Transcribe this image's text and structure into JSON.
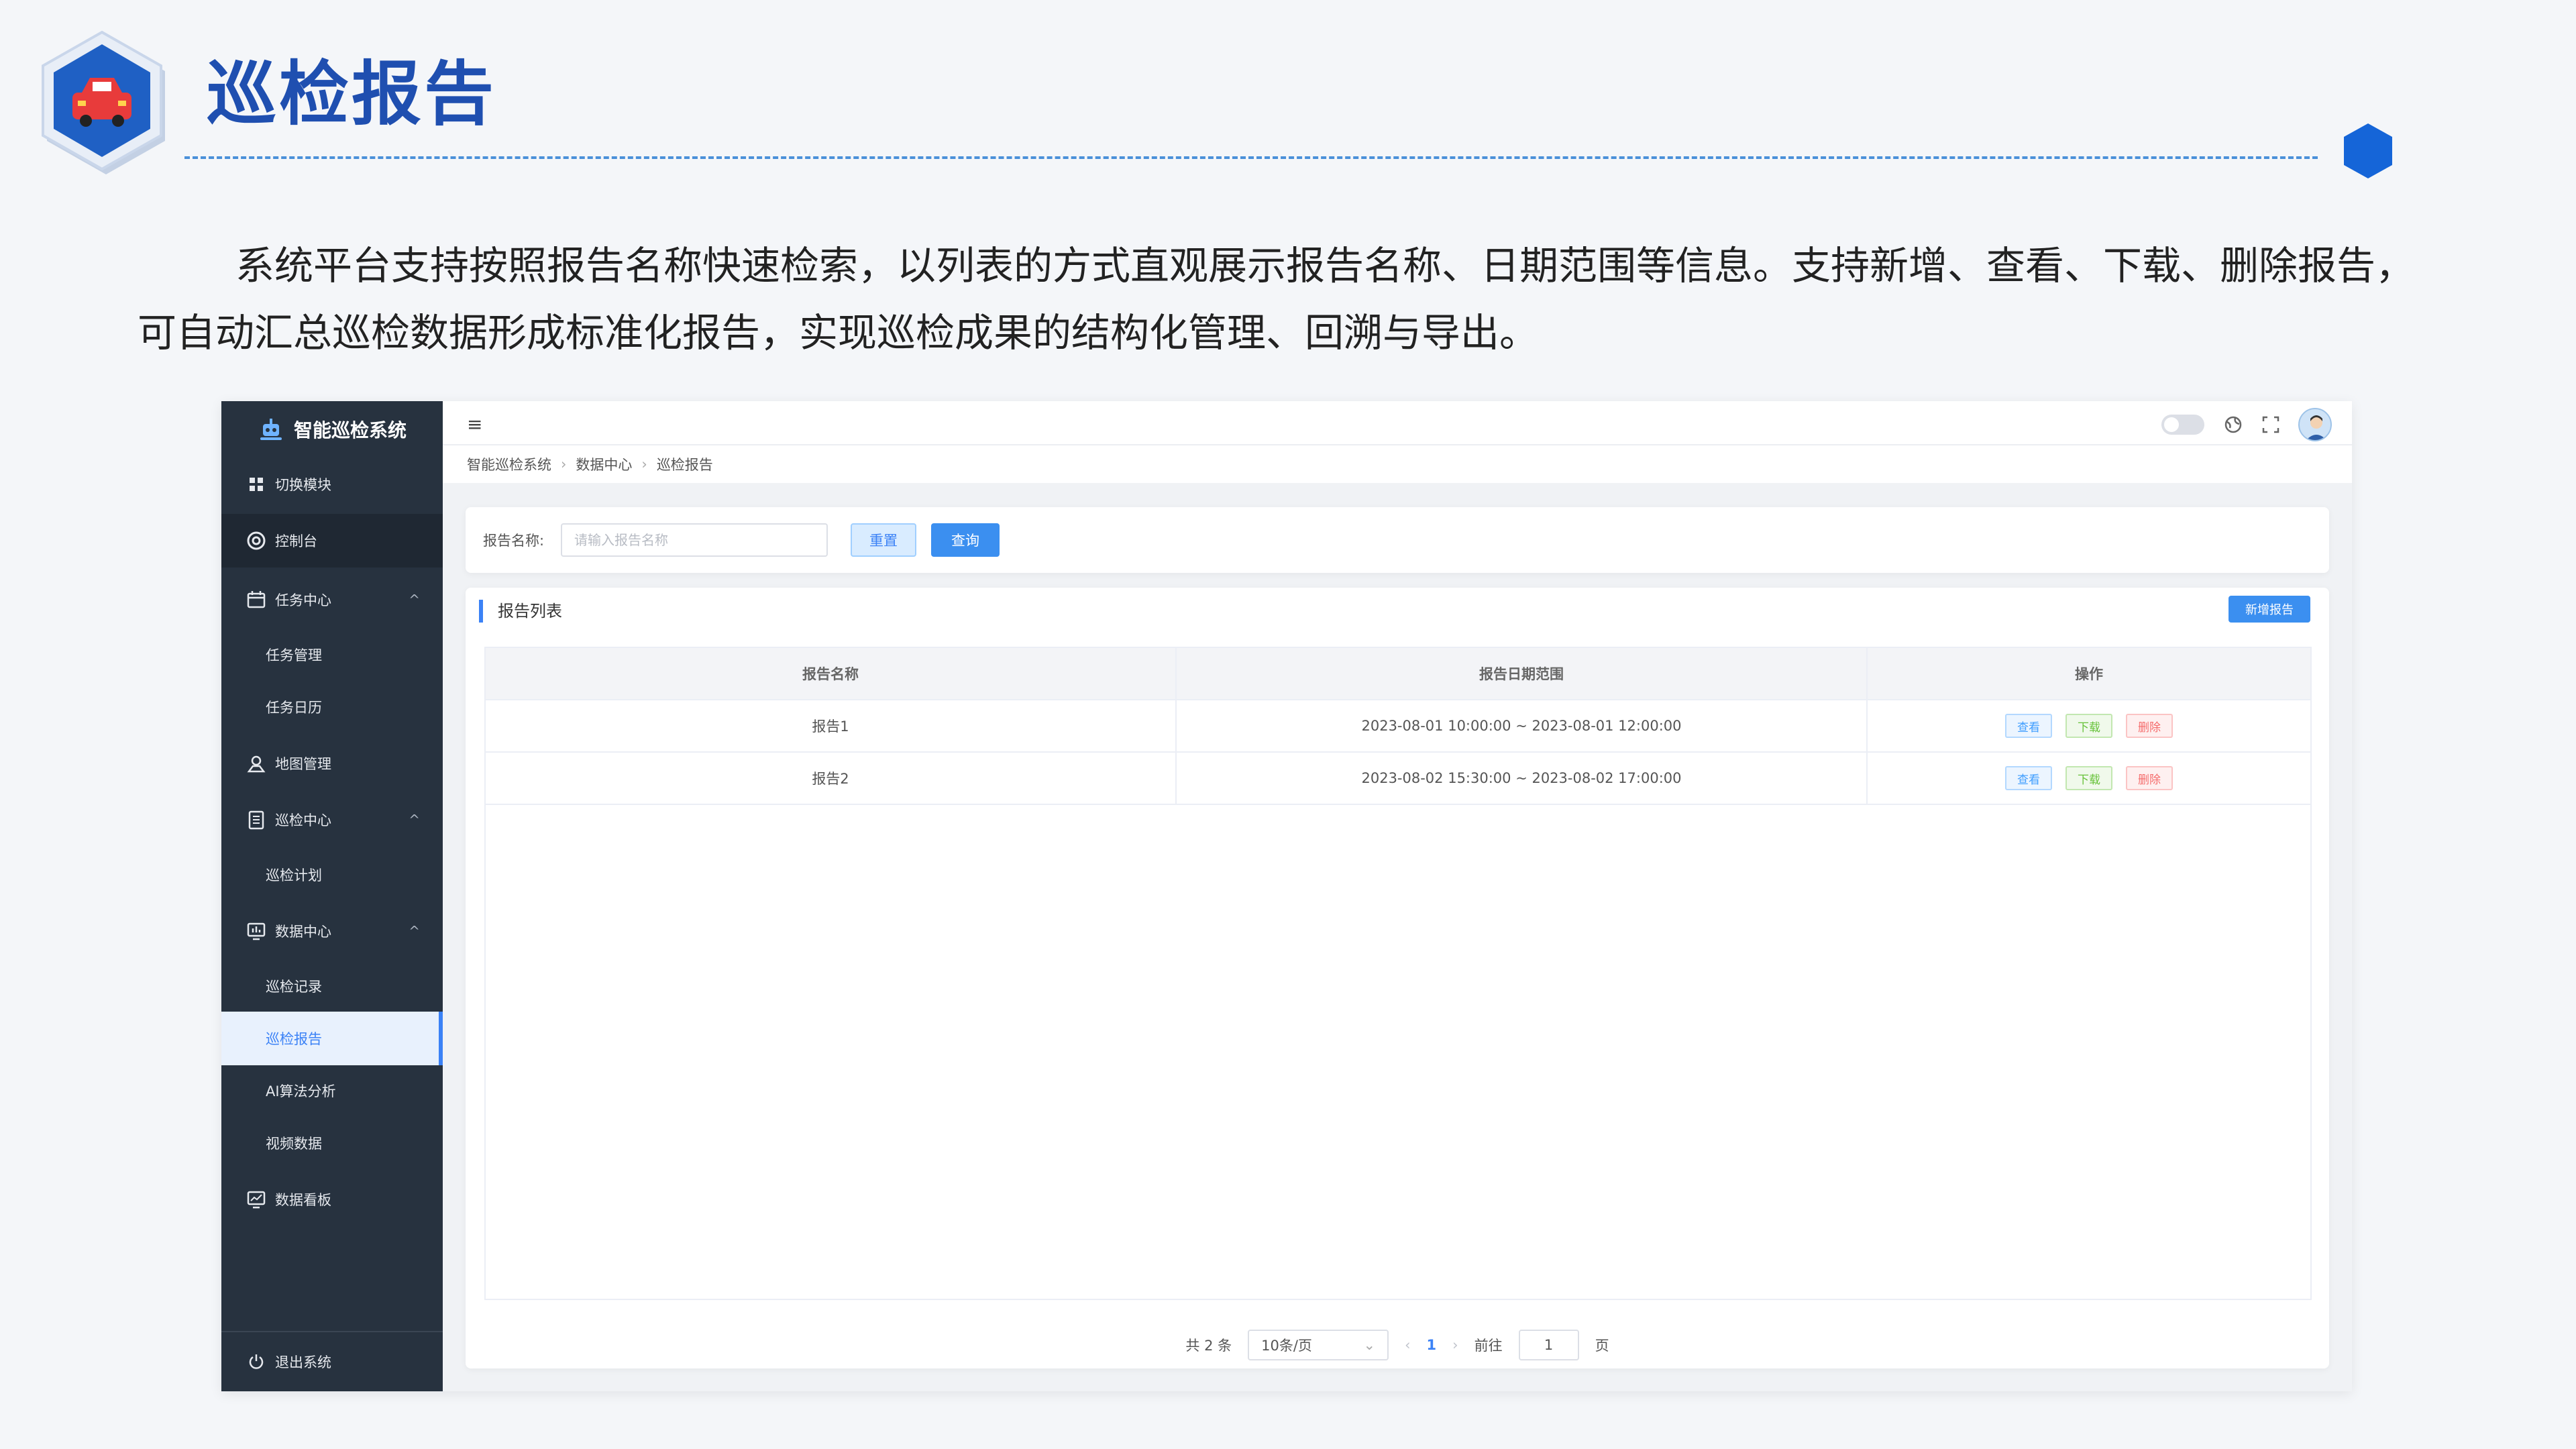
{
  "slide": {
    "title": "巡检报告",
    "intro": "系统平台支持按照报告名称快速检索，以列表的方式直观展示报告名称、日期范围等信息。支持新增、查看、下载、删除报告，可自动汇总巡检数据形成标准化报告，实现巡检成果的结构化管理、回溯与导出。",
    "logo_icon": "car-icon",
    "accent_color": "#1f4fb0"
  },
  "app": {
    "brand": "智能巡检系统",
    "sidebar": {
      "items": [
        {
          "label": "切换模块",
          "icon": "grid-icon"
        },
        {
          "label": "控制台",
          "icon": "dashboard-icon"
        },
        {
          "label": "任务中心",
          "icon": "calendar-icon"
        },
        {
          "label": "任务管理"
        },
        {
          "label": "任务日历"
        },
        {
          "label": "地图管理",
          "icon": "map-pin-icon"
        },
        {
          "label": "巡检中心",
          "icon": "clipboard-icon"
        },
        {
          "label": "巡检计划"
        },
        {
          "label": "数据中心",
          "icon": "chart-icon"
        },
        {
          "label": "巡检记录"
        },
        {
          "label": "巡检报告"
        },
        {
          "label": "AI算法分析"
        },
        {
          "label": "视频数据"
        },
        {
          "label": "数据看板",
          "icon": "monitor-icon"
        }
      ],
      "logout": "退出系统"
    },
    "breadcrumb": [
      "智能巡检系统",
      "数据中心",
      "巡检报告"
    ],
    "search": {
      "label": "报告名称:",
      "placeholder": "请输入报告名称",
      "value": "",
      "reset": "重置",
      "query": "查询"
    },
    "list": {
      "title": "报告列表",
      "add_button": "新增报告",
      "columns": [
        "报告名称",
        "报告日期范围",
        "操作"
      ],
      "rows": [
        {
          "name": "报告1",
          "range": "2023-08-01 10:00:00 ~ 2023-08-01 12:00:00"
        },
        {
          "name": "报告2",
          "range": "2023-08-02 15:30:00 ~ 2023-08-02 17:00:00"
        }
      ],
      "actions": {
        "view": "查看",
        "download": "下载",
        "delete": "删除"
      }
    },
    "pagination": {
      "total": "共 2 条",
      "page_size": "10条/页",
      "current_page": "1",
      "goto_label": "前往",
      "goto_value": "1",
      "page_unit": "页"
    }
  }
}
